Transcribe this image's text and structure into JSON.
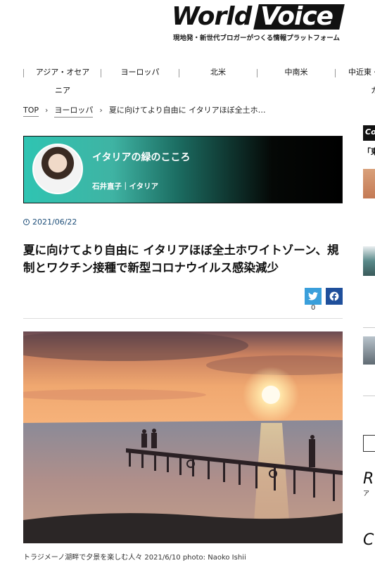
{
  "site": {
    "logo_world": "World",
    "logo_voice": "Voice",
    "tagline": "現地発・新世代ブロガーがつくる情報プラットフォーム"
  },
  "nav": {
    "items": [
      {
        "label": "アジア・オセア"
      },
      {
        "label": "ニア"
      },
      {
        "label": "ヨーロッパ"
      },
      {
        "label": "北米"
      },
      {
        "label": "中南米"
      },
      {
        "label": "中近東・"
      },
      {
        "label": "カ"
      }
    ]
  },
  "breadcrumb": {
    "top": "TOP",
    "category": "ヨーロッパ",
    "current": "夏に向けてより自由に イタリアほぼ全土ホ…",
    "sep": "›"
  },
  "author": {
    "blog_title": "イタリアの緑のこころ",
    "name_region": "石井直子｜イタリア"
  },
  "article": {
    "date": "2021/06/22",
    "headline": "夏に向けてより自由に イタリアほぼ全土ホワイトゾーン、規制とワクチン接種で新型コロナウイルス感染減少",
    "share_count": "0",
    "caption": "トラジメーノ湖畔で夕景を楽しむ人々 2021/6/10 photo: Naoko Ishii"
  },
  "sidebar": {
    "badge": "Co",
    "snippet": "「東",
    "section_r": "R",
    "section_r_sub": "ア",
    "section_c": "C"
  },
  "colors": {
    "twitter": "#3a9fdb",
    "facebook": "#1f4f9b",
    "date_blue": "#1c4d78"
  },
  "icons": [
    "clock-icon",
    "twitter-icon",
    "facebook-icon"
  ]
}
